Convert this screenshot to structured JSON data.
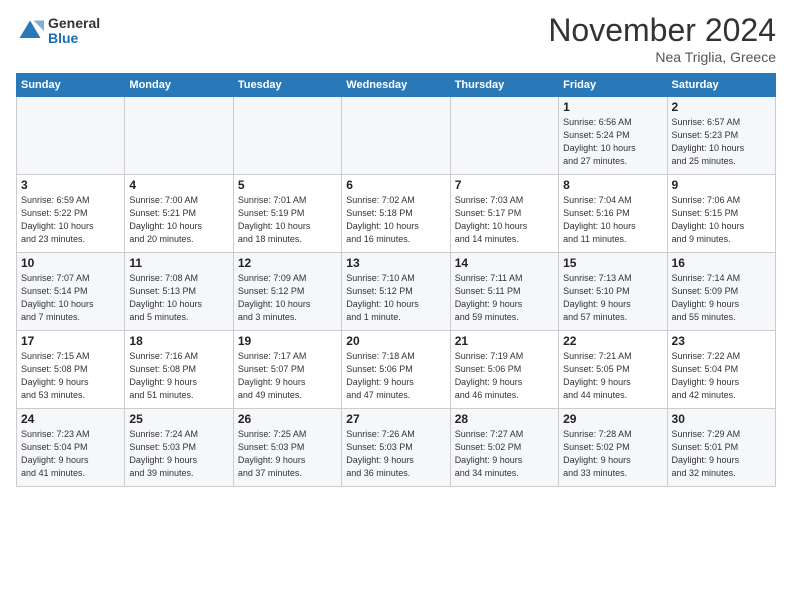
{
  "header": {
    "logo_general": "General",
    "logo_blue": "Blue",
    "month": "November 2024",
    "location": "Nea Triglia, Greece"
  },
  "weekdays": [
    "Sunday",
    "Monday",
    "Tuesday",
    "Wednesday",
    "Thursday",
    "Friday",
    "Saturday"
  ],
  "weeks": [
    [
      {
        "day": "",
        "info": ""
      },
      {
        "day": "",
        "info": ""
      },
      {
        "day": "",
        "info": ""
      },
      {
        "day": "",
        "info": ""
      },
      {
        "day": "",
        "info": ""
      },
      {
        "day": "1",
        "info": "Sunrise: 6:56 AM\nSunset: 5:24 PM\nDaylight: 10 hours\nand 27 minutes."
      },
      {
        "day": "2",
        "info": "Sunrise: 6:57 AM\nSunset: 5:23 PM\nDaylight: 10 hours\nand 25 minutes."
      }
    ],
    [
      {
        "day": "3",
        "info": "Sunrise: 6:59 AM\nSunset: 5:22 PM\nDaylight: 10 hours\nand 23 minutes."
      },
      {
        "day": "4",
        "info": "Sunrise: 7:00 AM\nSunset: 5:21 PM\nDaylight: 10 hours\nand 20 minutes."
      },
      {
        "day": "5",
        "info": "Sunrise: 7:01 AM\nSunset: 5:19 PM\nDaylight: 10 hours\nand 18 minutes."
      },
      {
        "day": "6",
        "info": "Sunrise: 7:02 AM\nSunset: 5:18 PM\nDaylight: 10 hours\nand 16 minutes."
      },
      {
        "day": "7",
        "info": "Sunrise: 7:03 AM\nSunset: 5:17 PM\nDaylight: 10 hours\nand 14 minutes."
      },
      {
        "day": "8",
        "info": "Sunrise: 7:04 AM\nSunset: 5:16 PM\nDaylight: 10 hours\nand 11 minutes."
      },
      {
        "day": "9",
        "info": "Sunrise: 7:06 AM\nSunset: 5:15 PM\nDaylight: 10 hours\nand 9 minutes."
      }
    ],
    [
      {
        "day": "10",
        "info": "Sunrise: 7:07 AM\nSunset: 5:14 PM\nDaylight: 10 hours\nand 7 minutes."
      },
      {
        "day": "11",
        "info": "Sunrise: 7:08 AM\nSunset: 5:13 PM\nDaylight: 10 hours\nand 5 minutes."
      },
      {
        "day": "12",
        "info": "Sunrise: 7:09 AM\nSunset: 5:12 PM\nDaylight: 10 hours\nand 3 minutes."
      },
      {
        "day": "13",
        "info": "Sunrise: 7:10 AM\nSunset: 5:12 PM\nDaylight: 10 hours\nand 1 minute."
      },
      {
        "day": "14",
        "info": "Sunrise: 7:11 AM\nSunset: 5:11 PM\nDaylight: 9 hours\nand 59 minutes."
      },
      {
        "day": "15",
        "info": "Sunrise: 7:13 AM\nSunset: 5:10 PM\nDaylight: 9 hours\nand 57 minutes."
      },
      {
        "day": "16",
        "info": "Sunrise: 7:14 AM\nSunset: 5:09 PM\nDaylight: 9 hours\nand 55 minutes."
      }
    ],
    [
      {
        "day": "17",
        "info": "Sunrise: 7:15 AM\nSunset: 5:08 PM\nDaylight: 9 hours\nand 53 minutes."
      },
      {
        "day": "18",
        "info": "Sunrise: 7:16 AM\nSunset: 5:08 PM\nDaylight: 9 hours\nand 51 minutes."
      },
      {
        "day": "19",
        "info": "Sunrise: 7:17 AM\nSunset: 5:07 PM\nDaylight: 9 hours\nand 49 minutes."
      },
      {
        "day": "20",
        "info": "Sunrise: 7:18 AM\nSunset: 5:06 PM\nDaylight: 9 hours\nand 47 minutes."
      },
      {
        "day": "21",
        "info": "Sunrise: 7:19 AM\nSunset: 5:06 PM\nDaylight: 9 hours\nand 46 minutes."
      },
      {
        "day": "22",
        "info": "Sunrise: 7:21 AM\nSunset: 5:05 PM\nDaylight: 9 hours\nand 44 minutes."
      },
      {
        "day": "23",
        "info": "Sunrise: 7:22 AM\nSunset: 5:04 PM\nDaylight: 9 hours\nand 42 minutes."
      }
    ],
    [
      {
        "day": "24",
        "info": "Sunrise: 7:23 AM\nSunset: 5:04 PM\nDaylight: 9 hours\nand 41 minutes."
      },
      {
        "day": "25",
        "info": "Sunrise: 7:24 AM\nSunset: 5:03 PM\nDaylight: 9 hours\nand 39 minutes."
      },
      {
        "day": "26",
        "info": "Sunrise: 7:25 AM\nSunset: 5:03 PM\nDaylight: 9 hours\nand 37 minutes."
      },
      {
        "day": "27",
        "info": "Sunrise: 7:26 AM\nSunset: 5:03 PM\nDaylight: 9 hours\nand 36 minutes."
      },
      {
        "day": "28",
        "info": "Sunrise: 7:27 AM\nSunset: 5:02 PM\nDaylight: 9 hours\nand 34 minutes."
      },
      {
        "day": "29",
        "info": "Sunrise: 7:28 AM\nSunset: 5:02 PM\nDaylight: 9 hours\nand 33 minutes."
      },
      {
        "day": "30",
        "info": "Sunrise: 7:29 AM\nSunset: 5:01 PM\nDaylight: 9 hours\nand 32 minutes."
      }
    ]
  ]
}
